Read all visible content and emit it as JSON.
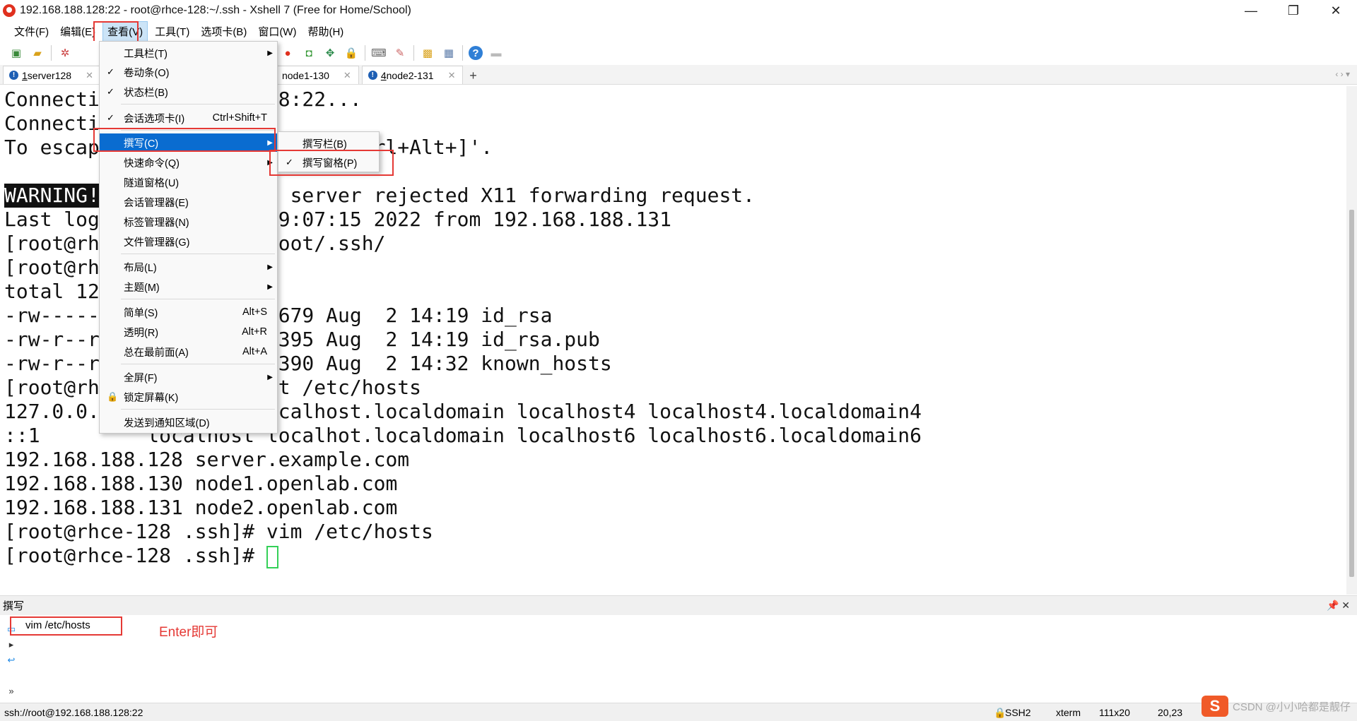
{
  "window": {
    "title": "192.168.188.128:22 - root@rhce-128:~/.ssh - Xshell 7 (Free for Home/School)",
    "controls": [
      "—",
      "❐",
      "✕"
    ]
  },
  "menubar": [
    "文件(F)",
    "编辑(E)",
    "查看(V)",
    "工具(T)",
    "选项卡(B)",
    "窗口(W)",
    "帮助(H)"
  ],
  "tabs": [
    {
      "num": "1",
      "label": " server128"
    },
    {
      "num": "",
      "label": "node1-130"
    },
    {
      "num": "4",
      "label": " node2-131"
    }
  ],
  "terminal": {
    "lines": [
      "Connecti          88.128:22...",
      "Connecti",
      "To escap                    'Ctrl+Alt+]'.",
      "",
      "                        server rejected X11 forwarding request.",
      "Last log              19:07:15 2022 from 192.168.188.131",
      "[root@rh              root/.ssh/",
      "[root@rh              l",
      "total 12",
      "-rw-----              1679 Aug  2 14:19 id_rsa",
      "-rw-r--r               395 Aug  2 14:19 id_rsa.pub",
      "-rw-r--r               390 Aug  2 14:32 known_hosts",
      "[root@rh              at /etc/hosts",
      "127.0.0.              ocalhost.localdomain localhost4 localhost4.localdomain4",
      "::1         localhost localhot.localdomain localhost6 localhost6.localdomain6",
      "192.168.188.128 server.example.com",
      "192.168.188.130 node1.openlab.com",
      "192.168.188.131 node2.openlab.com",
      "[root@rhce-128 .ssh]# vim /etc/hosts",
      "[root@rhce-128 .ssh]# "
    ],
    "warning": "WARNING!"
  },
  "view_menu": {
    "items": [
      {
        "check": "",
        "label": "工具栏(T)",
        "shortcut": "",
        "arrow": "▶"
      },
      {
        "check": "✓",
        "label": "卷动条(O)",
        "shortcut": "",
        "arrow": ""
      },
      {
        "check": "✓",
        "label": "状态栏(B)",
        "shortcut": "",
        "arrow": ""
      },
      {
        "check": "✓",
        "label": "会话选项卡(I)",
        "shortcut": "Ctrl+Shift+T",
        "arrow": ""
      },
      {
        "check": "",
        "label": "撰写(C)",
        "shortcut": "",
        "arrow": "▶"
      },
      {
        "check": "",
        "label": "快速命令(Q)",
        "shortcut": "",
        "arrow": "▶"
      },
      {
        "check": "",
        "label": "隧道窗格(U)",
        "shortcut": "",
        "arrow": ""
      },
      {
        "check": "",
        "label": "会话管理器(E)",
        "shortcut": "",
        "arrow": ""
      },
      {
        "check": "",
        "label": "标签管理器(N)",
        "shortcut": "",
        "arrow": ""
      },
      {
        "check": "",
        "label": "文件管理器(G)",
        "shortcut": "",
        "arrow": ""
      },
      {
        "check": "",
        "label": "布局(L)",
        "shortcut": "",
        "arrow": "▶"
      },
      {
        "check": "",
        "label": "主题(M)",
        "shortcut": "",
        "arrow": "▶"
      },
      {
        "check": "",
        "label": "简单(S)",
        "shortcut": "Alt+S",
        "arrow": ""
      },
      {
        "check": "",
        "label": "透明(R)",
        "shortcut": "Alt+R",
        "arrow": ""
      },
      {
        "check": "",
        "label": "总在最前面(A)",
        "shortcut": "Alt+A",
        "arrow": ""
      },
      {
        "check": "",
        "label": "全屏(F)",
        "shortcut": "",
        "arrow": "▶"
      },
      {
        "check": "🔒",
        "label": "锁定屏幕(K)",
        "shortcut": "",
        "arrow": ""
      },
      {
        "check": "",
        "label": "发送到通知区域(D)",
        "shortcut": "",
        "arrow": ""
      }
    ]
  },
  "compose_submenu": [
    {
      "check": "",
      "label": "撰写栏(B)"
    },
    {
      "check": "✓",
      "label": "撰写窗格(P)"
    }
  ],
  "compose": {
    "title": "撰写",
    "pin": "📌 ✕",
    "input": "vim /etc/hosts",
    "note": "Enter即可"
  },
  "statusbar": {
    "path": "ssh://root@192.168.188.128:22",
    "protocol": "SSH2",
    "term": "xterm",
    "size": "111x20",
    "pos": "20,23"
  },
  "watermark": {
    "logo": "S",
    "text": "CSDN @小小哈都是靓仔"
  }
}
